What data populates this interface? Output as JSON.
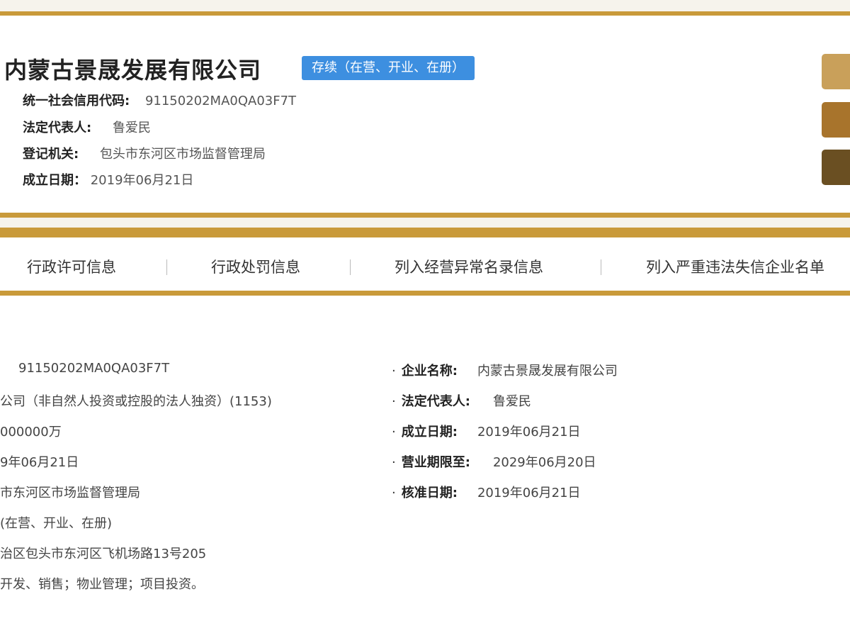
{
  "company": {
    "name": "内蒙古景晟发展有限公司",
    "status": "存续（在营、开业、在册）"
  },
  "summary": {
    "credit_code_label": "统一社会信用代码:",
    "credit_code": "91150202MA0QA03F7T",
    "legal_rep_label": "法定代表人:",
    "legal_rep": "鲁爱民",
    "authority_label": "登记机关:",
    "authority": "包头市东河区市场监督管理局",
    "established_label": "成立日期：",
    "established": "2019年06月21日"
  },
  "side_buttons": [
    {
      "name": "side-button-1",
      "color": "#c9a05a"
    },
    {
      "name": "side-button-2",
      "color": "#a8742c"
    },
    {
      "name": "side-button-3",
      "color": "#6a4f22"
    }
  ],
  "tabs": [
    {
      "label": "行政许可信息"
    },
    {
      "label": "行政处罚信息"
    },
    {
      "label": "列入经营异常名录信息"
    },
    {
      "label": "列入严重违法失信企业名单"
    }
  ],
  "details_left": [
    "91150202MA0QA03F7T",
    "公司（非自然人投资或控股的法人独资）(1153)",
    "000000万",
    "9年06月21日",
    "市东河区市场监督管理局",
    "(在营、开业、在册)",
    "治区包头市东河区飞机场路13号205",
    "开发、销售；物业管理；项目投资。"
  ],
  "details_right": [
    {
      "label": "企业名称:",
      "value": "内蒙古景晟发展有限公司"
    },
    {
      "label": "法定代表人:",
      "value": "鲁爱民"
    },
    {
      "label": "成立日期:",
      "value": "2019年06月21日"
    },
    {
      "label": "营业期限至:",
      "value": "2029年06月20日"
    },
    {
      "label": "核准日期:",
      "value": "2019年06月21日"
    }
  ],
  "colors": {
    "accent_gold": "#c99a3a",
    "status_blue": "#3d8fe0"
  }
}
